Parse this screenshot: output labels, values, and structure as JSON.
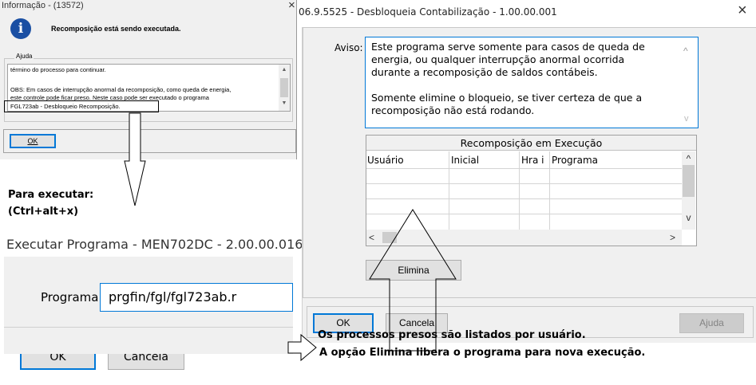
{
  "left_dialog": {
    "title": "Informação - (13572)",
    "close": "×",
    "message": "Recomposição está sendo executada.",
    "group_label": "Ajuda",
    "help_lines": [
      "término do processo para continuar.",
      "",
      "OBS: Em casos de interrupção anormal da recomposição, como queda de energia,",
      "este controle pode ficar preso. Neste caso pode ser executado o programa",
      "FGL723ab - Desbloqueio Recomposição."
    ],
    "ok_label": "OK"
  },
  "shortcut_note": {
    "line1": "Para executar:",
    "line2": "(Ctrl+alt+x)"
  },
  "exec_dialog": {
    "title": "Executar Programa - MEN702DC - 2.00.00.016",
    "program_label": "Programa:",
    "program_value": "prgfin/fgl/fgl723ab.r",
    "ok_label": "OK",
    "cancel_label": "Cancela"
  },
  "main_dialog": {
    "title": "06.9.5525 - Desbloqueia Contabilização - 1.00.00.001",
    "close": "×",
    "aviso_label": "Aviso:",
    "aviso_lines": [
      "Este programa serve somente para casos de queda de",
      "energia, ou qualquer interrupção anormal ocorrida",
      "durante a recomposição de saldos contábeis.",
      "",
      "Somente elimine o bloqueio, se tiver certeza de que a",
      "recomposição não está rodando."
    ],
    "grid_title": "Recomposição em Execução",
    "columns": [
      "Usuário",
      "Inicial",
      "Hra i",
      "Programa"
    ],
    "elimina_label": "Elimina",
    "ok_label": "OK",
    "cancel_label": "Cancela",
    "help_label": "Ajuda"
  },
  "annotation": {
    "line1": "Os processos presos são listados por usuário.",
    "line2": "A opção Elimina libera o programa para nova execução."
  },
  "icons": {
    "info": "info-icon",
    "scroll_up": "▲",
    "scroll_down": "▼",
    "scroll_left": "<",
    "scroll_right": ">",
    "chevron_up": "^",
    "chevron_down": "v"
  }
}
